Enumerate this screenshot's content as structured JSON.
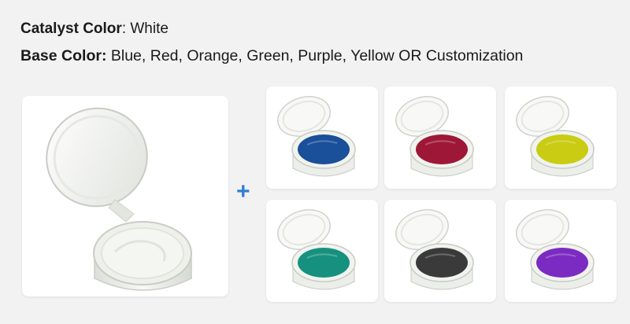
{
  "header": {
    "catalyst_label": "Catalyst Color",
    "catalyst_value": ": White",
    "base_label": "Base Color:",
    "base_value": " Blue, Red, Orange, Green, Purple, Yellow OR Customization"
  },
  "plus_symbol": "+",
  "colors": {
    "plus": "#2f7fd6",
    "catalyst_paste": "#f4f6f1"
  },
  "base_swatches": [
    {
      "color": "#1a4f9a"
    },
    {
      "color": "#9e1737"
    },
    {
      "color": "#c9cc13"
    },
    {
      "color": "#17917f"
    },
    {
      "color": "#3a3a3a"
    },
    {
      "color": "#7c2bc2"
    }
  ]
}
